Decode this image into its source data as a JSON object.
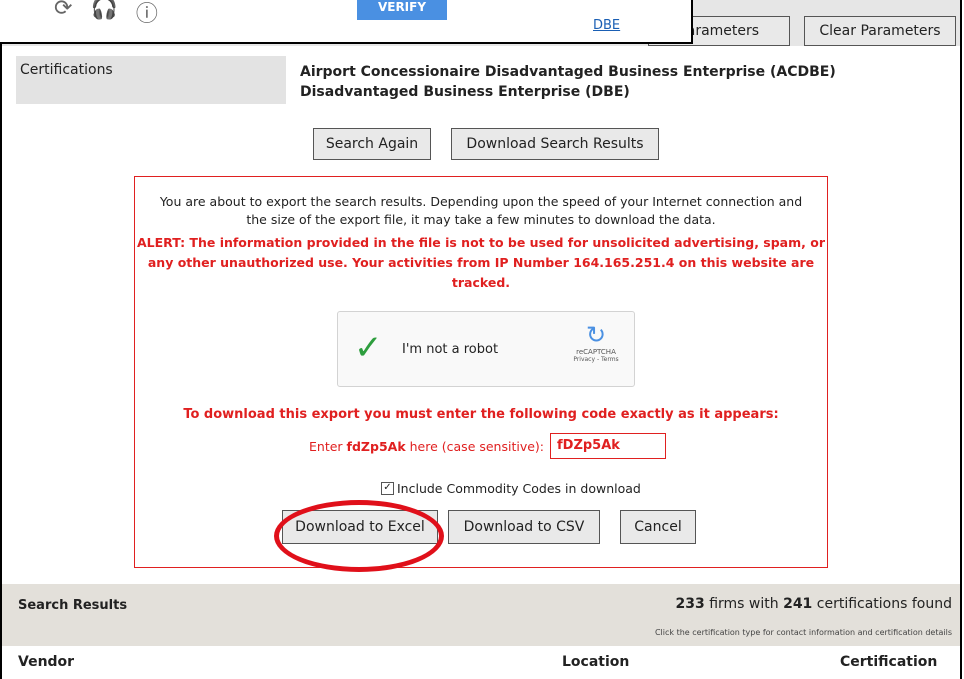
{
  "top_buttons": {
    "params_label": "Parameters",
    "clear_label": "Clear Parameters"
  },
  "popup": {
    "verify_label": "VERIFY",
    "link_text": "DBE"
  },
  "certifications": {
    "label": "Certifications",
    "values": [
      "Airport Concessionaire Disadvantaged Business Enterprise (ACDBE)",
      "Disadvantaged Business Enterprise (DBE)"
    ]
  },
  "actions": {
    "search_again": "Search Again",
    "download_results": "Download Search Results"
  },
  "export": {
    "intro_line1": "You are about to export the search results. Depending upon the speed of your Internet connection and",
    "intro_line2": "the size of the export file, it may take a few minutes to download the data.",
    "alert_line1": "ALERT: The information provided in the file is not to be used for unsolicited advertising, spam, or",
    "alert_line2": "any other unauthorized use. Your activities from IP Number 164.165.251.4 on this website are",
    "alert_line3": "tracked.",
    "captcha_label": "I'm not a robot",
    "captcha_brand": "reCAPTCHA",
    "captcha_links": "Privacy - Terms",
    "code_instruction": "To download this export you must enter the following code exactly as it appears:",
    "enter_prefix": "Enter",
    "code": "fdZp5Ak",
    "enter_suffix": "here (case sensitive):",
    "code_input_value": "fDZp5Ak",
    "include_label": "Include Commodity Codes in download",
    "include_checked": true,
    "btn_excel": "Download to Excel",
    "btn_csv": "Download to CSV",
    "btn_cancel": "Cancel"
  },
  "results": {
    "title": "Search Results",
    "firms_count": "233",
    "firms_text": "firms with",
    "cert_count": "241",
    "cert_text": "certifications found",
    "hint": "Click the certification type for contact information and certification details",
    "col_vendor": "Vendor",
    "col_location": "Location",
    "col_certification": "Certification"
  },
  "colors": {
    "alert_red": "#e02020",
    "highlight_ring": "#e0101a",
    "captcha_check": "#2e9e3e",
    "verify_blue": "#4a90e2"
  }
}
